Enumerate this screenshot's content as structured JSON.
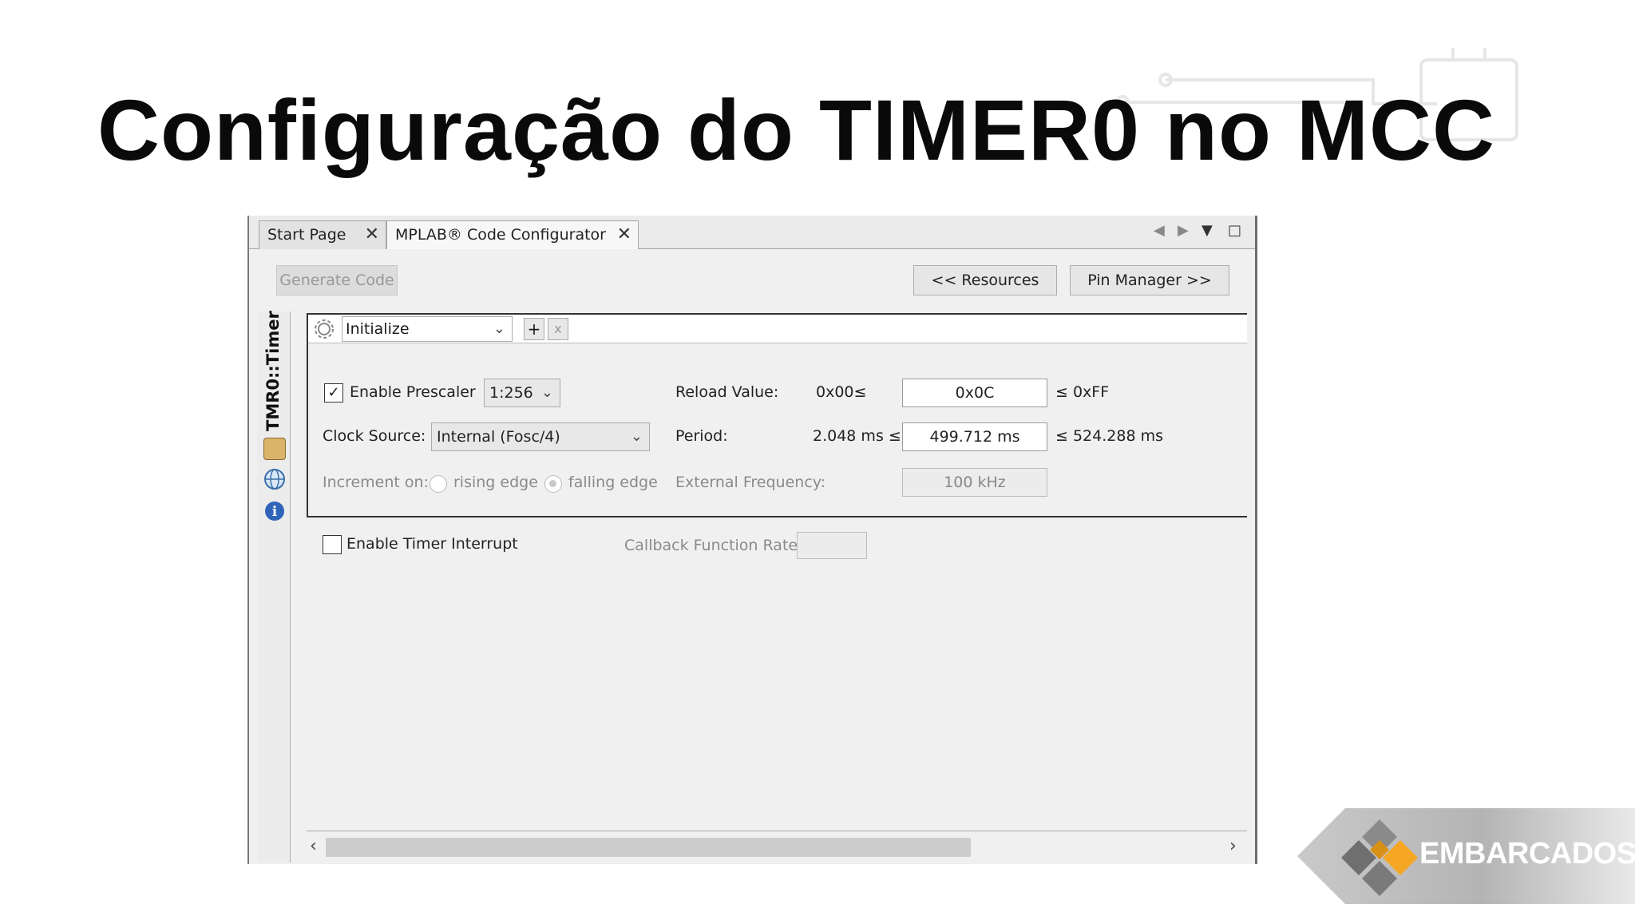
{
  "slide": {
    "title": "Configuração do TIMER0 no MCC"
  },
  "ide": {
    "tabs": [
      {
        "label": "Start Page",
        "close": "✕"
      },
      {
        "label": "MPLAB® Code Configurator",
        "close": "✕"
      }
    ],
    "toolbar": {
      "generate_code": "Generate Code",
      "resources": "<< Resources",
      "pin_manager": "Pin Manager >>"
    },
    "side_label": "TMR0::Timer",
    "function_selector": {
      "value": "Initialize",
      "add": "+",
      "remove": "x"
    },
    "config": {
      "enable_prescaler_label": "Enable Prescaler",
      "prescaler_checked": true,
      "prescaler_value": "1:256",
      "clock_source_label": "Clock Source:",
      "clock_source_value": "Internal (Fosc/4)",
      "increment_label": "Increment on:",
      "rising_edge": "rising edge",
      "falling_edge": "falling edge",
      "reload_label": "Reload Value:",
      "reload_min": "0x00≤",
      "reload_value": "0x0C",
      "reload_max": "≤ 0xFF",
      "period_label": "Period:",
      "period_min": "2.048 ms ≤",
      "period_value": "499.712 ms",
      "period_max": "≤ 524.288 ms",
      "ext_freq_label": "External Frequency:",
      "ext_freq_value": "100 kHz"
    },
    "interrupt": {
      "enable_label": "Enable Timer Interrupt",
      "checked": false,
      "callback_label": "Callback Function Rate:",
      "callback_value": ""
    },
    "scroll": {
      "left": "‹",
      "right": "›"
    }
  },
  "logo": {
    "text": "EMBARCADOS"
  },
  "icons": [
    "gear-icon",
    "chip-icon",
    "globe-icon",
    "info-icon",
    "checkmark-icon",
    "chevron-down-icon",
    "close-icon"
  ]
}
